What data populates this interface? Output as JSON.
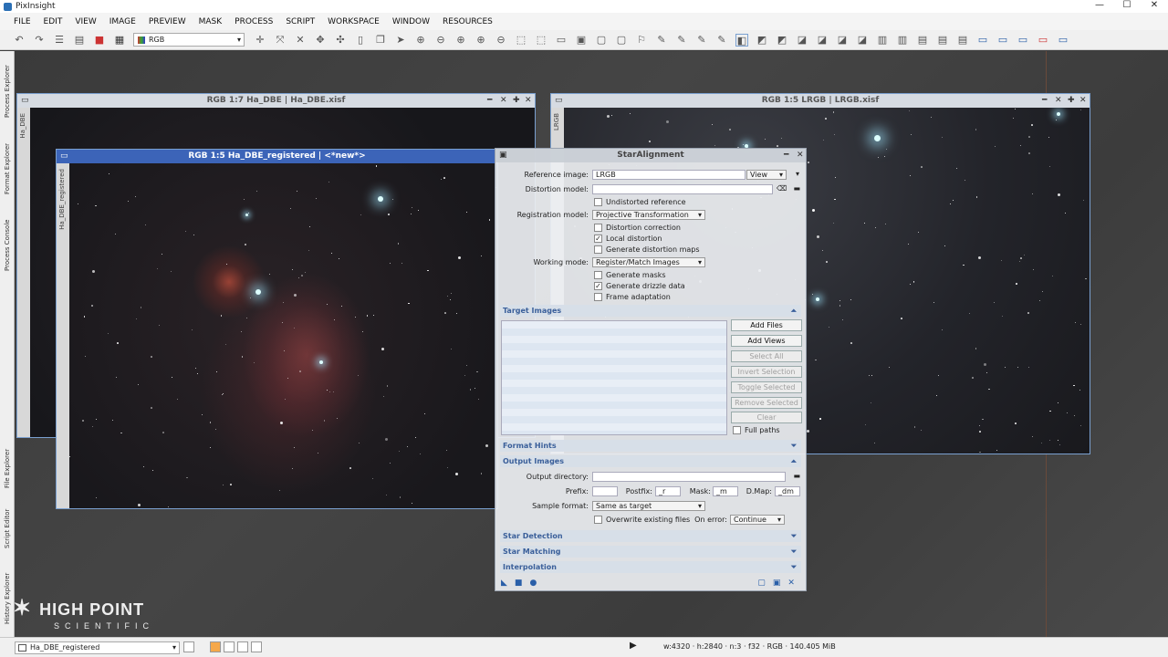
{
  "app": {
    "title": "PixInsight"
  },
  "menu": [
    "FILE",
    "EDIT",
    "VIEW",
    "IMAGE",
    "PREVIEW",
    "MASK",
    "PROCESS",
    "SCRIPT",
    "WORKSPACE",
    "WINDOW",
    "RESOURCES"
  ],
  "toolbar": {
    "color_space": "RGB"
  },
  "side_tabs": [
    "Process Explorer",
    "Format Explorer",
    "Process Console",
    "File Explorer",
    "Script Editor",
    "History Explorer"
  ],
  "windows": {
    "ha_dbe": {
      "title": "RGB 1:7 Ha_DBE | Ha_DBE.xisf",
      "tab": "Ha_DBE"
    },
    "lrgb": {
      "title": "RGB 1:5 LRGB | LRGB.xisf",
      "tab": "LRGB"
    },
    "ha_dbe_registered": {
      "title": "RGB 1:5 Ha_DBE_registered | <*new*>",
      "tab": "Ha_DBE_registered"
    }
  },
  "dialog": {
    "title": "StarAlignment",
    "reference_image_label": "Reference image:",
    "reference_image_value": "LRGB",
    "reference_mode": "View",
    "distortion_model_label": "Distortion model:",
    "undistorted_reference": "Undistorted reference",
    "registration_model_label": "Registration model:",
    "registration_model_value": "Projective Transformation",
    "distortion_correction": "Distortion correction",
    "local_distortion": "Local distortion",
    "generate_distortion_maps": "Generate distortion maps",
    "working_mode_label": "Working mode:",
    "working_mode_value": "Register/Match Images",
    "generate_masks": "Generate masks",
    "generate_drizzle_data": "Generate drizzle data",
    "frame_adaptation": "Frame adaptation",
    "target_images": "Target Images",
    "buttons": {
      "add_files": "Add Files",
      "add_views": "Add Views",
      "select_all": "Select All",
      "invert_selection": "Invert Selection",
      "toggle_selected": "Toggle Selected",
      "remove_selected": "Remove Selected",
      "clear": "Clear"
    },
    "full_paths": "Full paths",
    "format_hints": "Format Hints",
    "output_images": "Output Images",
    "output_directory_label": "Output directory:",
    "prefix_label": "Prefix:",
    "postfix_label": "Postfix:",
    "postfix_value": "_r",
    "mask_label": "Mask:",
    "mask_value": "_m",
    "dmap_label": "D.Map:",
    "dmap_value": "_dm",
    "sample_format_label": "Sample format:",
    "sample_format_value": "Same as target",
    "overwrite_existing": "Overwrite existing files",
    "on_error_label": "On error:",
    "on_error_value": "Continue",
    "star_detection": "Star Detection",
    "star_matching": "Star Matching",
    "interpolation": "Interpolation"
  },
  "logo": {
    "line1": "HIGH POINT",
    "line2": "SCIENTIFIC"
  },
  "status": {
    "view": "Ha_DBE_registered",
    "info": "w:4320 · h:2840 · n:3 · f32 · RGB · 140.405 MiB"
  }
}
